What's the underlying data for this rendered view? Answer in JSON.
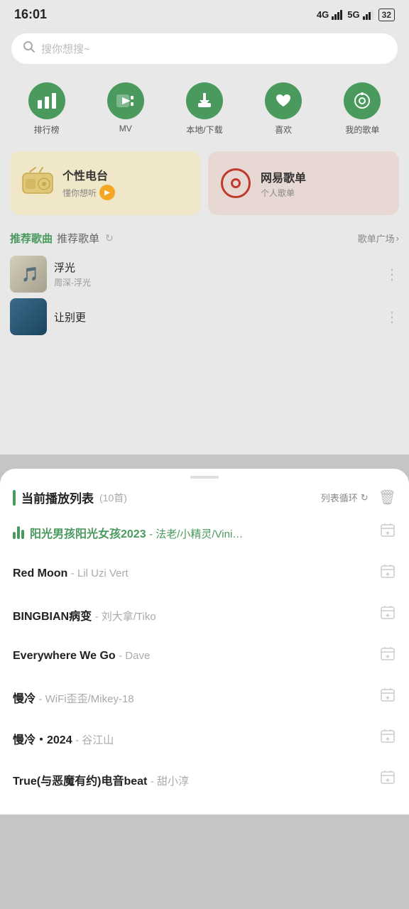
{
  "statusBar": {
    "time": "16:01",
    "signal1": "4G",
    "signal2": "5G",
    "battery": "32"
  },
  "search": {
    "placeholder": "搜你想搜~"
  },
  "navIcons": [
    {
      "id": "ranking",
      "label": "排行榜",
      "icon": "📊"
    },
    {
      "id": "mv",
      "label": "MV",
      "icon": "▶"
    },
    {
      "id": "download",
      "label": "本地/下载",
      "icon": "⬇"
    },
    {
      "id": "favorites",
      "label": "喜欢",
      "icon": "♥"
    },
    {
      "id": "my-playlist",
      "label": "我的歌单",
      "icon": "◎"
    }
  ],
  "cards": [
    {
      "id": "personal-radio",
      "title": "个性电台",
      "subtitle": "懂你想听",
      "bg": "left"
    },
    {
      "id": "netease-playlist",
      "title": "网易歌单",
      "subtitle": "个人歌单",
      "bg": "right"
    }
  ],
  "tabs": [
    {
      "id": "recommended-songs",
      "label": "推荐歌曲",
      "active": true
    },
    {
      "id": "recommended-playlists",
      "label": "推荐歌单",
      "active": false
    }
  ],
  "playlistLink": "歌单广场",
  "songs": [
    {
      "id": "song1",
      "title": "浮光",
      "artist": "周深-浮光",
      "thumb": "gradient1"
    },
    {
      "id": "song2",
      "title": "让别更",
      "artist": "",
      "thumb": "gradient2"
    }
  ],
  "bottomSheet": {
    "title": "当前播放列表",
    "count": "(10首)",
    "loopLabel": "列表循环",
    "playlist": [
      {
        "id": "pl1",
        "name": "阳光男孩阳光女孩2023",
        "artist": "法老/小精灵/Vini…",
        "active": true
      },
      {
        "id": "pl2",
        "name": "Red Moon",
        "artist": "Lil Uzi Vert",
        "active": false
      },
      {
        "id": "pl3",
        "name": "BINGBIAN病变",
        "artist": "刘大拿/Tiko",
        "active": false
      },
      {
        "id": "pl4",
        "name": "Everywhere We Go",
        "artist": "Dave",
        "active": false
      },
      {
        "id": "pl5",
        "name": "慢冷",
        "artist": "WiFi歪歪/Mikey-18",
        "active": false
      },
      {
        "id": "pl6",
        "name": "慢冷・2024",
        "artist": "谷江山",
        "active": false
      },
      {
        "id": "pl7",
        "name": "True(与恶魔有约)电音beat",
        "artist": "甜小淳",
        "active": false
      }
    ]
  }
}
